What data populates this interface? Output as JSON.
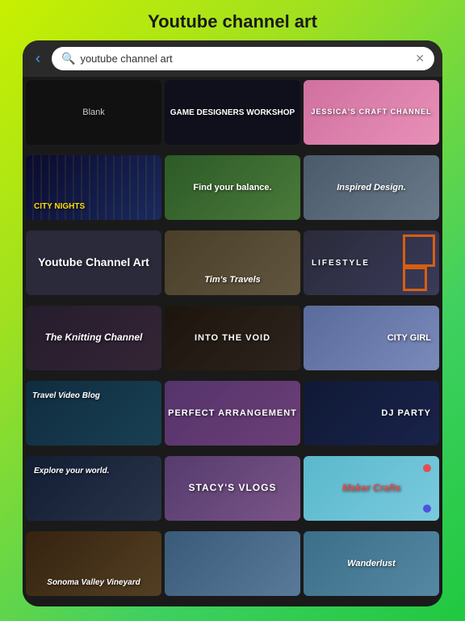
{
  "page": {
    "title": "Youtube channel art",
    "background": "green-gradient"
  },
  "search": {
    "placeholder": "youtube channel art",
    "value": "youtube channel art",
    "back_label": "<",
    "clear_label": "✕"
  },
  "icons": {
    "search": "🔍",
    "back": "‹",
    "clear": "✕"
  },
  "cards": [
    {
      "id": "blank",
      "label": "Blank",
      "style": "blank"
    },
    {
      "id": "game-designers",
      "label": "GAME DESIGNERS WORKSHOP",
      "style": "game"
    },
    {
      "id": "jessica",
      "label": "JESSICA'S CRAFT CHANNEL",
      "style": "jessica"
    },
    {
      "id": "city-nights",
      "label": "CITY NIGHTS",
      "style": "city-nights"
    },
    {
      "id": "balance",
      "label": "Find your balance.",
      "style": "balance"
    },
    {
      "id": "inspired",
      "label": "Inspired Design.",
      "style": "inspired"
    },
    {
      "id": "youtube-channel",
      "label": "Youtube Channel Art",
      "style": "youtube-channel"
    },
    {
      "id": "tim-travels",
      "label": "Tim's Travels",
      "style": "tim-travels"
    },
    {
      "id": "lifestyle",
      "label": "LIFESTYLE",
      "style": "lifestyle"
    },
    {
      "id": "knitting",
      "label": "The Knitting Channel",
      "style": "knitting"
    },
    {
      "id": "void",
      "label": "INTO THE VOID",
      "style": "void"
    },
    {
      "id": "city-girl",
      "label": "CITY GIRL",
      "style": "city-girl"
    },
    {
      "id": "travel-blog",
      "label": "Travel Video Blog",
      "style": "travel-blog"
    },
    {
      "id": "perfect",
      "label": "PERFECT ARRANGEMENT",
      "style": "perfect"
    },
    {
      "id": "dj-party",
      "label": "DJ PARTY",
      "style": "dj"
    },
    {
      "id": "explore",
      "label": "Explore your world.",
      "style": "explore"
    },
    {
      "id": "stacy",
      "label": "STACY'S VLOGS",
      "style": "stacy"
    },
    {
      "id": "maker",
      "label": "Maker Crafts",
      "style": "maker"
    },
    {
      "id": "sonoma",
      "label": "Sonoma Valley Vineyard",
      "style": "sonoma"
    },
    {
      "id": "mountains",
      "label": "",
      "style": "mountains"
    },
    {
      "id": "wanderlust",
      "label": "Wanderlust",
      "style": "wanderlust"
    }
  ]
}
